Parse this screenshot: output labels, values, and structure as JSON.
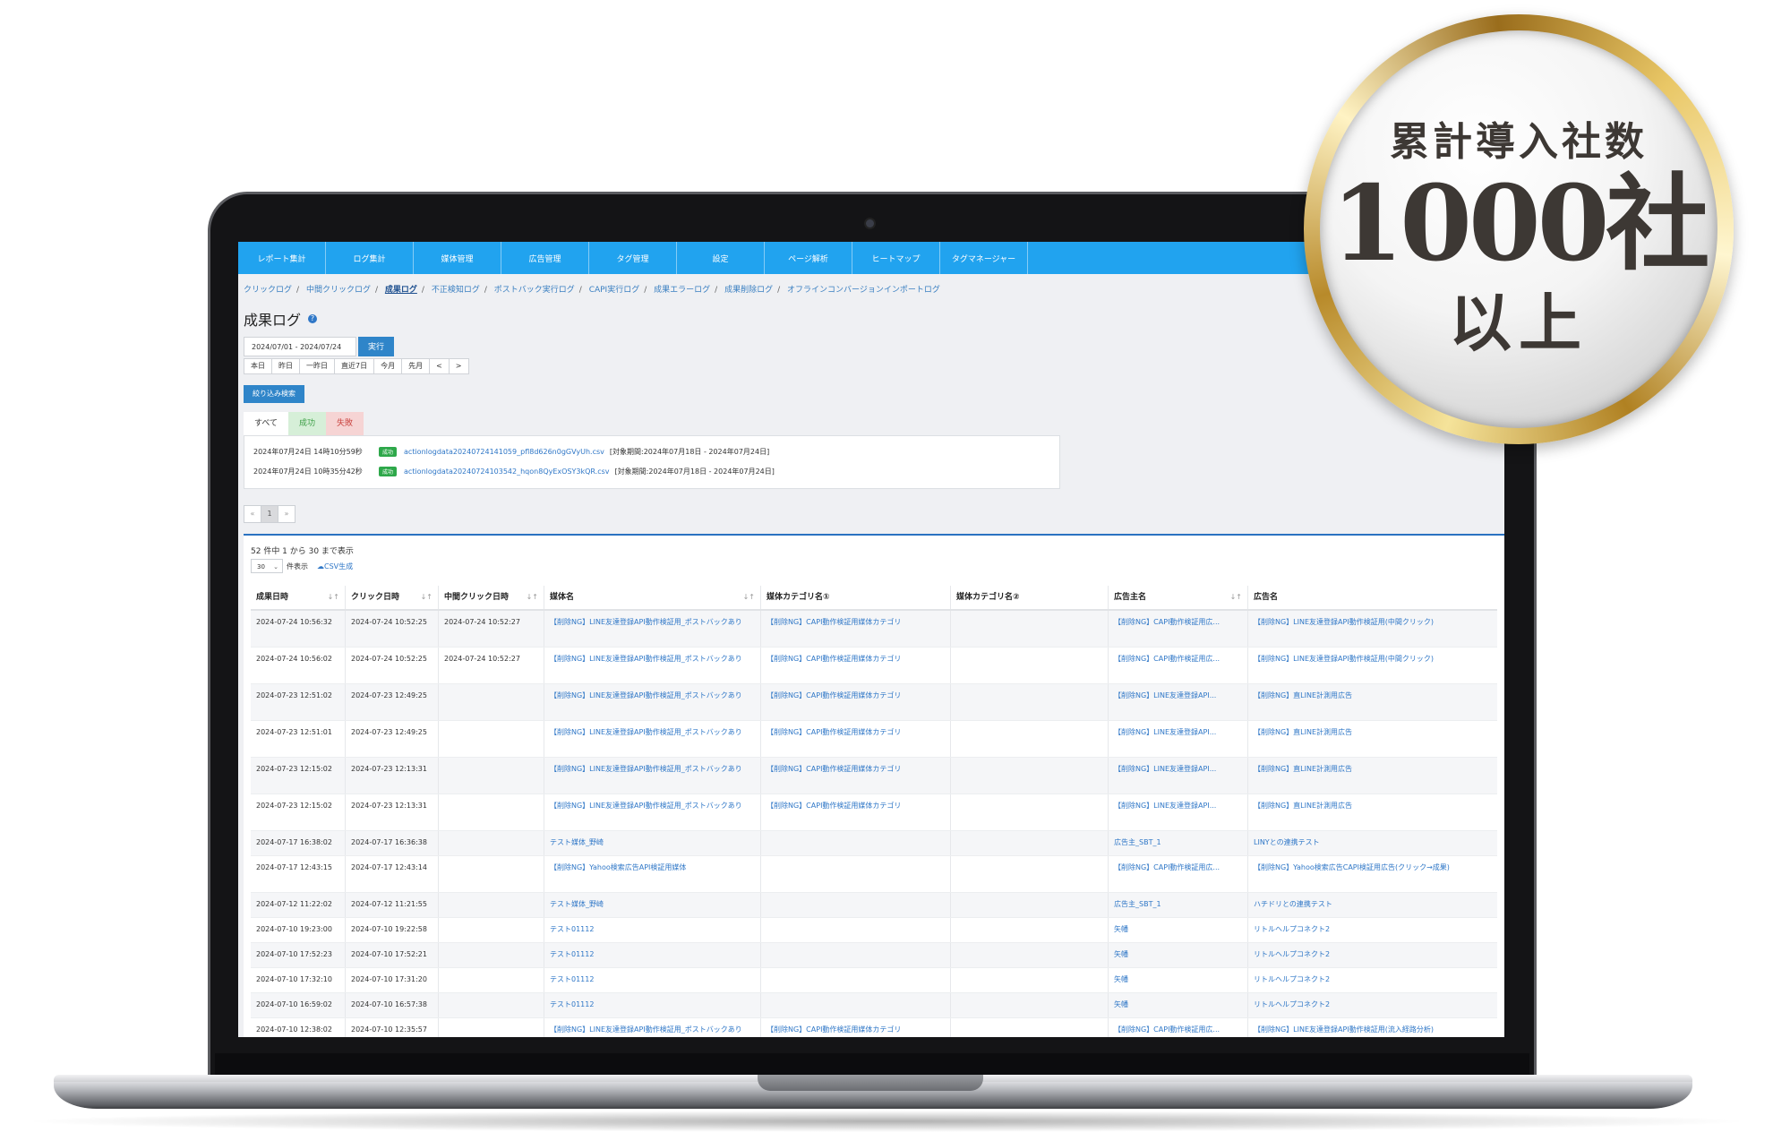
{
  "nav": [
    "レポート集計",
    "ログ集計",
    "媒体管理",
    "広告管理",
    "タグ管理",
    "設定",
    "ページ解析",
    "ヒートマップ",
    "タグマネージャー"
  ],
  "breadcrumbs": [
    "クリックログ",
    "中間クリックログ",
    "成果ログ",
    "不正検知ログ",
    "ポストバック実行ログ",
    "CAPI実行ログ",
    "成果エラーログ",
    "成果削除ログ",
    "オフラインコンバージョンインポートログ"
  ],
  "page_title": "成果ログ",
  "help_icon": "?",
  "date_range": "2024/07/01 - 2024/07/24",
  "run_label": "実行",
  "range_buttons": [
    "本日",
    "昨日",
    "一昨日",
    "直近7日",
    "今月",
    "先月",
    "<",
    ">"
  ],
  "filter_label": "絞り込み検索",
  "tabs": {
    "all": "すべて",
    "success": "成功",
    "fail": "失敗"
  },
  "files": [
    {
      "datetime": "2024年07月24日 14時10分59秒",
      "status": "成功",
      "filename": "actionlogdata20240724141059_pfl8d626n0gGVyUh.csv",
      "period": "[対象期間:2024年07月18日 - 2024年07月24日]"
    },
    {
      "datetime": "2024年07月24日 10時35分42秒",
      "status": "成功",
      "filename": "actionlogdata20240724103542_hqon8QyExOSY3kQR.csv",
      "period": "[対象期間:2024年07月18日 - 2024年07月24日]"
    }
  ],
  "pager": {
    "prev": "«",
    "current": "1",
    "next": "»"
  },
  "count_text": "52 件中 1 から 30 まで表示",
  "per_page": {
    "value": "30",
    "label": "件表示"
  },
  "csv_label": "☁CSV生成",
  "columns": [
    "成果日時",
    "クリック日時",
    "中間クリック日時",
    "媒体名",
    "媒体カテゴリ名①",
    "媒体カテゴリ名②",
    "広告主名",
    "広告名"
  ],
  "rows": [
    [
      "2024-07-24 10:56:32",
      "2024-07-24 10:52:25",
      "2024-07-24 10:52:27",
      "【削除NG】LINE友達登録API動作検証用_ポストバックあり",
      "【削除NG】CAPI動作検証用媒体カテゴリ",
      "",
      "【削除NG】CAPI動作検証用広...",
      "【削除NG】LINE友達登録API動作検証用(中間クリック)"
    ],
    [
      "2024-07-24 10:56:02",
      "2024-07-24 10:52:25",
      "2024-07-24 10:52:27",
      "【削除NG】LINE友達登録API動作検証用_ポストバックあり",
      "【削除NG】CAPI動作検証用媒体カテゴリ",
      "",
      "【削除NG】CAPI動作検証用広...",
      "【削除NG】LINE友達登録API動作検証用(中間クリック)"
    ],
    [
      "2024-07-23 12:51:02",
      "2024-07-23 12:49:25",
      "",
      "【削除NG】LINE友達登録API動作検証用_ポストバックあり",
      "【削除NG】CAPI動作検証用媒体カテゴリ",
      "",
      "【削除NG】LINE友達登録API...",
      "【削除NG】直LINE計測用広告"
    ],
    [
      "2024-07-23 12:51:01",
      "2024-07-23 12:49:25",
      "",
      "【削除NG】LINE友達登録API動作検証用_ポストバックあり",
      "【削除NG】CAPI動作検証用媒体カテゴリ",
      "",
      "【削除NG】LINE友達登録API...",
      "【削除NG】直LINE計測用広告"
    ],
    [
      "2024-07-23 12:15:02",
      "2024-07-23 12:13:31",
      "",
      "【削除NG】LINE友達登録API動作検証用_ポストバックあり",
      "【削除NG】CAPI動作検証用媒体カテゴリ",
      "",
      "【削除NG】LINE友達登録API...",
      "【削除NG】直LINE計測用広告"
    ],
    [
      "2024-07-23 12:15:02",
      "2024-07-23 12:13:31",
      "",
      "【削除NG】LINE友達登録API動作検証用_ポストバックあり",
      "【削除NG】CAPI動作検証用媒体カテゴリ",
      "",
      "【削除NG】LINE友達登録API...",
      "【削除NG】直LINE計測用広告"
    ],
    [
      "2024-07-17 16:38:02",
      "2024-07-17 16:36:38",
      "",
      "テスト媒体_野崎",
      "",
      "",
      "広告主_SBT_1",
      "LINYとの連携テスト"
    ],
    [
      "2024-07-17 12:43:15",
      "2024-07-17 12:43:14",
      "",
      "【削除NG】Yahoo検索広告API検証用媒体",
      "",
      "",
      "【削除NG】CAPI動作検証用広...",
      "【削除NG】Yahoo検索広告CAPI検証用広告(クリック→成果)"
    ],
    [
      "2024-07-12 11:22:02",
      "2024-07-12 11:21:55",
      "",
      "テスト媒体_野崎",
      "",
      "",
      "広告主_SBT_1",
      "ハチドリとの連携テスト"
    ],
    [
      "2024-07-10 19:23:00",
      "2024-07-10 19:22:58",
      "",
      "テスト01112",
      "",
      "",
      "矢幡",
      "リトルヘルプコネクト2"
    ],
    [
      "2024-07-10 17:52:23",
      "2024-07-10 17:52:21",
      "",
      "テスト01112",
      "",
      "",
      "矢幡",
      "リトルヘルプコネクト2"
    ],
    [
      "2024-07-10 17:32:10",
      "2024-07-10 17:31:20",
      "",
      "テスト01112",
      "",
      "",
      "矢幡",
      "リトルヘルプコネクト2"
    ],
    [
      "2024-07-10 16:59:02",
      "2024-07-10 16:57:38",
      "",
      "テスト01112",
      "",
      "",
      "矢幡",
      "リトルヘルプコネクト2"
    ],
    [
      "2024-07-10 12:38:02",
      "2024-07-10 12:35:57",
      "",
      "【削除NG】LINE友達登録API動作検証用_ポストバックあり",
      "【削除NG】CAPI動作検証用媒体カテゴリ",
      "",
      "【削除NG】CAPI動作検証用広...",
      "【削除NG】LINE友達登録API動作検証用(流入経路分析)"
    ]
  ],
  "medal": {
    "line1": "累計導入社数",
    "line2": "1000社",
    "line3": "以上"
  },
  "colors": {
    "navbar": "#21a3ef",
    "link": "#2f77c7",
    "success": "#2ea84a",
    "gold": "#c9a13e"
  }
}
